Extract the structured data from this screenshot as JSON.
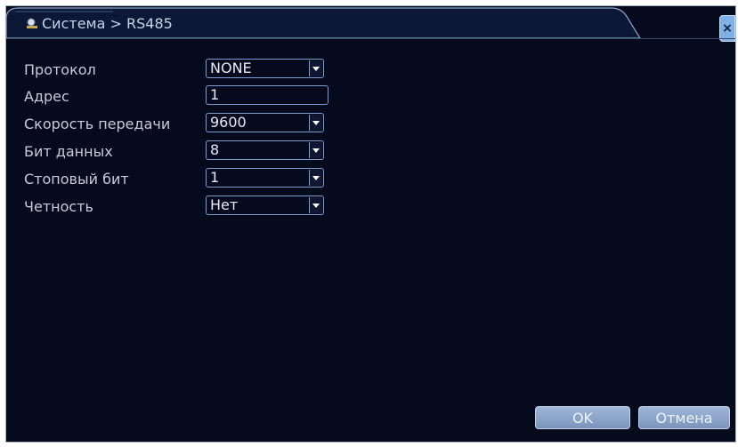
{
  "window": {
    "title": "Система > RS485",
    "close_label": "×"
  },
  "form": {
    "fields": [
      {
        "label": "Протокол",
        "value": "NONE",
        "type": "select"
      },
      {
        "label": "Адрес",
        "value": "1",
        "type": "input"
      },
      {
        "label": "Скорость передачи",
        "value": "9600",
        "type": "select"
      },
      {
        "label": "Бит данных",
        "value": "8",
        "type": "select"
      },
      {
        "label": "Стоповый бит",
        "value": "1",
        "type": "select"
      },
      {
        "label": "Четность",
        "value": "Нет",
        "type": "select"
      }
    ]
  },
  "buttons": {
    "ok": "OK",
    "cancel": "Отмена"
  },
  "colors": {
    "background": "#050a1c",
    "field_border": "#7a9ed1",
    "label_text": "#c6ccd9",
    "button": "#8aa4c9"
  },
  "icons": [
    "system-icon",
    "close-icon",
    "chevron-down-icon"
  ]
}
